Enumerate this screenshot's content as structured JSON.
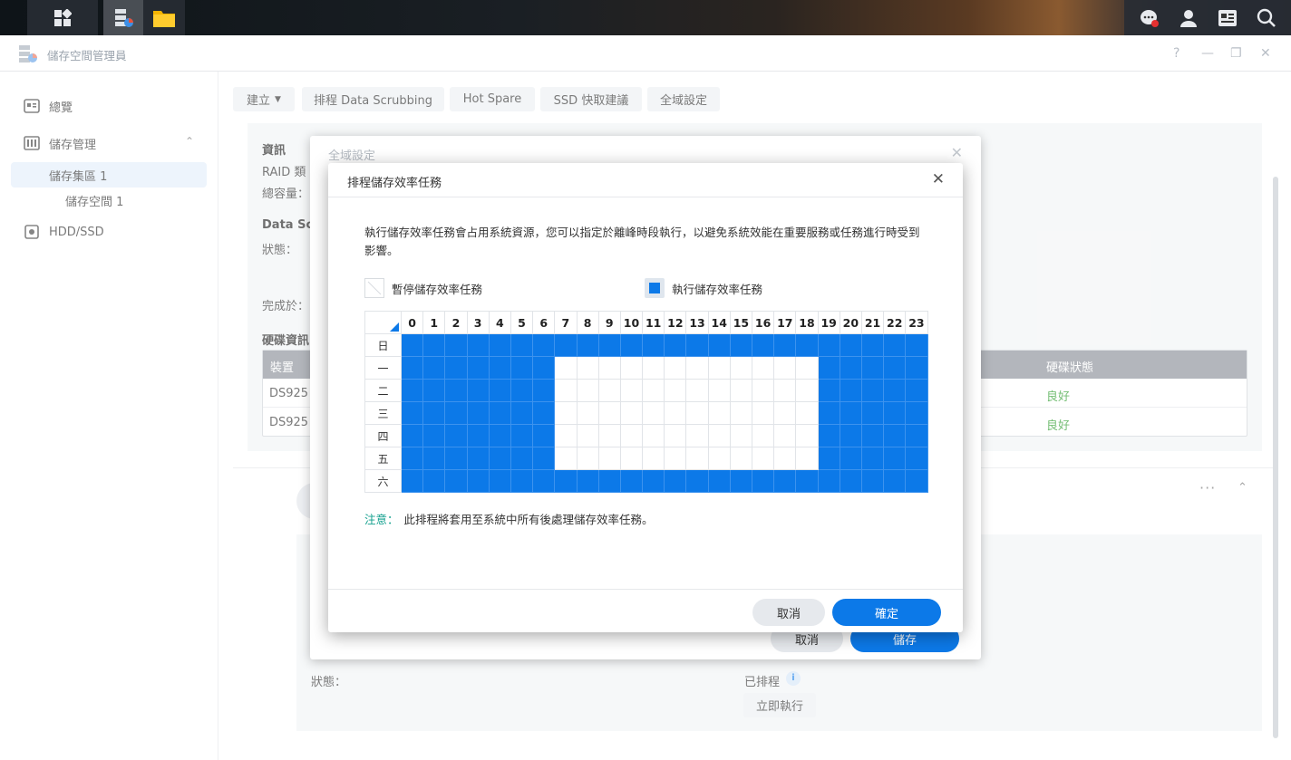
{
  "app": {
    "title": "儲存空間管理員"
  },
  "sidebar": {
    "items": [
      {
        "label": "總覽",
        "icon": "overview-icon"
      },
      {
        "label": "儲存管理",
        "icon": "storage-icon"
      },
      {
        "label": "儲存集區 1"
      },
      {
        "label": "儲存空間 1"
      },
      {
        "label": "HDD/SSD",
        "icon": "hdd-icon"
      }
    ]
  },
  "toolbar": {
    "create": "建立",
    "scrubbing": "排程 Data Scrubbing",
    "hotspare": "Hot Spare",
    "ssd": "SSD 快取建議",
    "global": "全域設定"
  },
  "info": {
    "info_label": "資訊",
    "raid_label": "RAID 類",
    "total_label": "總容量：",
    "data_label": "Data Sc",
    "status_label": "狀態：",
    "done_label": "完成於：",
    "disk_info": "硬碟資訊",
    "col_device": "裝置",
    "col_status": "硬碟狀態",
    "rows": [
      {
        "device": "DS925",
        "status": "良好"
      },
      {
        "device": "DS925",
        "status": "良好"
      }
    ]
  },
  "lower": {
    "status_label": "狀態：",
    "scheduled": "已排程",
    "run_now": "立即執行"
  },
  "bg_dialog": {
    "title": "全域設定",
    "cancel": "取消",
    "save": "儲存"
  },
  "dialog": {
    "title": "排程儲存效率任務",
    "description": "執行儲存效率任務會占用系統資源，您可以指定於離峰時段執行，以避免系統效能在重要服務或任務進行時受到影響。",
    "legend_pause": "暫停儲存效率任務",
    "legend_run": "執行儲存效率任務",
    "hours": [
      "0",
      "1",
      "2",
      "3",
      "4",
      "5",
      "6",
      "7",
      "8",
      "9",
      "10",
      "11",
      "12",
      "13",
      "14",
      "15",
      "16",
      "17",
      "18",
      "19",
      "20",
      "21",
      "22",
      "23"
    ],
    "days": [
      "日",
      "一",
      "二",
      "三",
      "四",
      "五",
      "六"
    ],
    "schedule": [
      [
        1,
        1,
        1,
        1,
        1,
        1,
        1,
        1,
        1,
        1,
        1,
        1,
        1,
        1,
        1,
        1,
        1,
        1,
        1,
        1,
        1,
        1,
        1,
        1
      ],
      [
        1,
        1,
        1,
        1,
        1,
        1,
        1,
        0,
        0,
        0,
        0,
        0,
        0,
        0,
        0,
        0,
        0,
        0,
        0,
        1,
        1,
        1,
        1,
        1
      ],
      [
        1,
        1,
        1,
        1,
        1,
        1,
        1,
        0,
        0,
        0,
        0,
        0,
        0,
        0,
        0,
        0,
        0,
        0,
        0,
        1,
        1,
        1,
        1,
        1
      ],
      [
        1,
        1,
        1,
        1,
        1,
        1,
        1,
        0,
        0,
        0,
        0,
        0,
        0,
        0,
        0,
        0,
        0,
        0,
        0,
        1,
        1,
        1,
        1,
        1
      ],
      [
        1,
        1,
        1,
        1,
        1,
        1,
        1,
        0,
        0,
        0,
        0,
        0,
        0,
        0,
        0,
        0,
        0,
        0,
        0,
        1,
        1,
        1,
        1,
        1
      ],
      [
        1,
        1,
        1,
        1,
        1,
        1,
        1,
        0,
        0,
        0,
        0,
        0,
        0,
        0,
        0,
        0,
        0,
        0,
        0,
        1,
        1,
        1,
        1,
        1
      ],
      [
        1,
        1,
        1,
        1,
        1,
        1,
        1,
        1,
        1,
        1,
        1,
        1,
        1,
        1,
        1,
        1,
        1,
        1,
        1,
        1,
        1,
        1,
        1,
        1
      ]
    ],
    "note_key": "注意：",
    "note_text": "此排程將套用至系統中所有後處理儲存效率任務。",
    "cancel": "取消",
    "ok": "確定"
  },
  "colors": {
    "accent": "#0c79e8",
    "ok": "#2b9c2b",
    "note": "#13a08e"
  }
}
